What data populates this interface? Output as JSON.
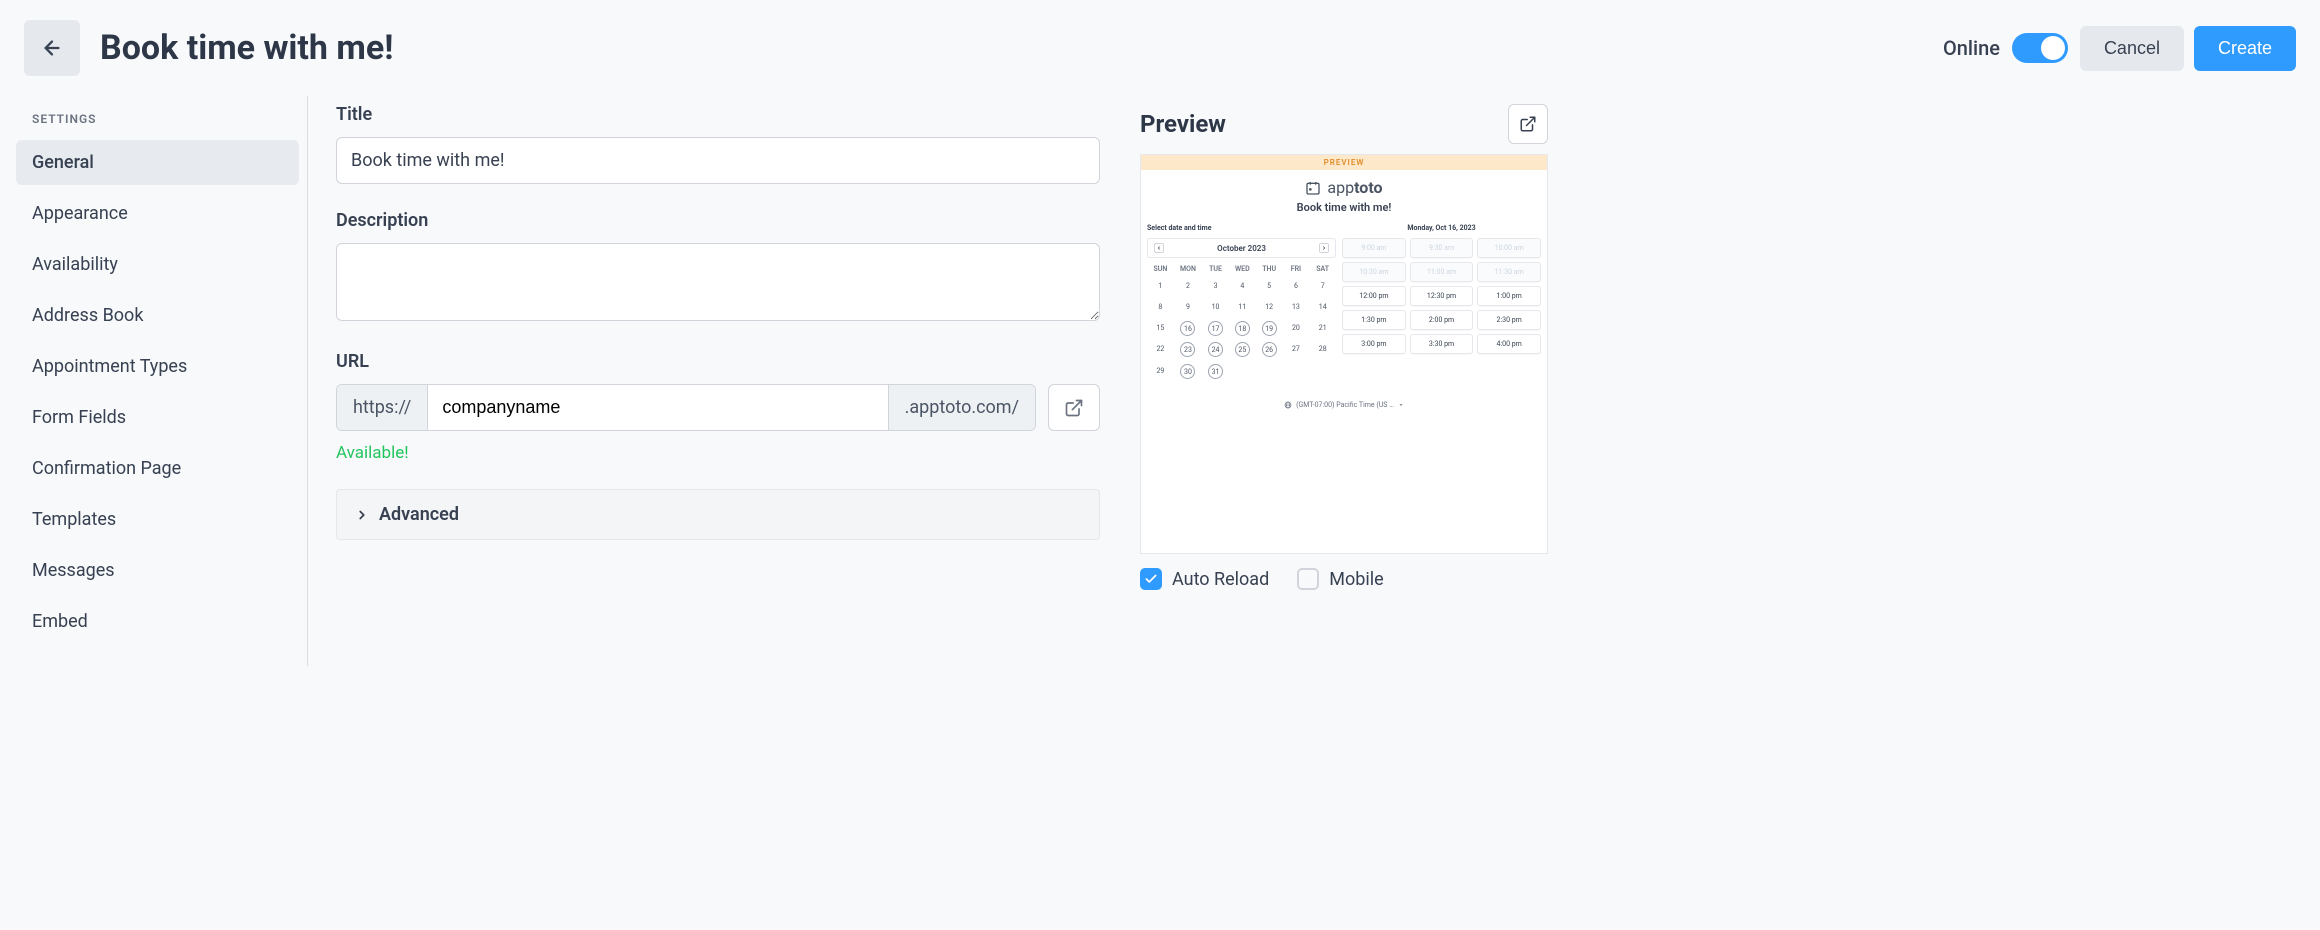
{
  "header": {
    "title": "Book time with me!",
    "status_label": "Online",
    "online": true,
    "cancel": "Cancel",
    "create": "Create"
  },
  "sidebar": {
    "heading": "SETTINGS",
    "items": [
      {
        "label": "General",
        "active": true
      },
      {
        "label": "Appearance",
        "active": false
      },
      {
        "label": "Availability",
        "active": false
      },
      {
        "label": "Address Book",
        "active": false
      },
      {
        "label": "Appointment Types",
        "active": false
      },
      {
        "label": "Form Fields",
        "active": false
      },
      {
        "label": "Confirmation Page",
        "active": false
      },
      {
        "label": "Templates",
        "active": false
      },
      {
        "label": "Messages",
        "active": false
      },
      {
        "label": "Embed",
        "active": false
      }
    ]
  },
  "form": {
    "title_label": "Title",
    "title_value": "Book time with me!",
    "description_label": "Description",
    "description_value": "",
    "url_label": "URL",
    "url_prefix": "https://",
    "url_value": "companyname",
    "url_suffix": ".apptoto.com/",
    "url_status": "Available!",
    "advanced_label": "Advanced"
  },
  "preview": {
    "heading": "Preview",
    "banner": "PREVIEW",
    "brand_prefix": "app",
    "brand_bold": "toto",
    "title": "Book time with me!",
    "select_label": "Select date and time",
    "month": "October 2023",
    "date_heading": "Monday, Oct 16, 2023",
    "weekdays": [
      "SUN",
      "MON",
      "TUE",
      "WED",
      "THU",
      "FRI",
      "SAT"
    ],
    "weeks": [
      [
        {
          "d": "1"
        },
        {
          "d": "2"
        },
        {
          "d": "3"
        },
        {
          "d": "4"
        },
        {
          "d": "5"
        },
        {
          "d": "6"
        },
        {
          "d": "7"
        }
      ],
      [
        {
          "d": "8"
        },
        {
          "d": "9"
        },
        {
          "d": "10"
        },
        {
          "d": "11"
        },
        {
          "d": "12"
        },
        {
          "d": "13"
        },
        {
          "d": "14"
        }
      ],
      [
        {
          "d": "15"
        },
        {
          "d": "16",
          "a": true
        },
        {
          "d": "17",
          "a": true
        },
        {
          "d": "18",
          "a": true
        },
        {
          "d": "19",
          "a": true
        },
        {
          "d": "20"
        },
        {
          "d": "21"
        }
      ],
      [
        {
          "d": "22"
        },
        {
          "d": "23",
          "a": true
        },
        {
          "d": "24",
          "a": true
        },
        {
          "d": "25",
          "a": true
        },
        {
          "d": "26",
          "a": true
        },
        {
          "d": "27"
        },
        {
          "d": "28"
        }
      ],
      [
        {
          "d": "29"
        },
        {
          "d": "30",
          "a": true
        },
        {
          "d": "31",
          "a": true
        },
        {
          "d": ""
        },
        {
          "d": ""
        },
        {
          "d": ""
        },
        {
          "d": ""
        }
      ]
    ],
    "slots": [
      {
        "t": "9:00 am",
        "dis": true
      },
      {
        "t": "9:30 am",
        "dis": true
      },
      {
        "t": "10:00 am",
        "dis": true
      },
      {
        "t": "10:30 am",
        "dis": true
      },
      {
        "t": "11:00 am",
        "dis": true
      },
      {
        "t": "11:30 am",
        "dis": true
      },
      {
        "t": "12:00 pm"
      },
      {
        "t": "12:30 pm"
      },
      {
        "t": "1:00 pm"
      },
      {
        "t": "1:30 pm"
      },
      {
        "t": "2:00 pm"
      },
      {
        "t": "2:30 pm"
      },
      {
        "t": "3:00 pm"
      },
      {
        "t": "3:30 pm"
      },
      {
        "t": "4:00 pm"
      }
    ],
    "timezone": "(GMT-07:00) Pacific Time (US …",
    "auto_reload_label": "Auto Reload",
    "auto_reload_checked": true,
    "mobile_label": "Mobile",
    "mobile_checked": false
  }
}
